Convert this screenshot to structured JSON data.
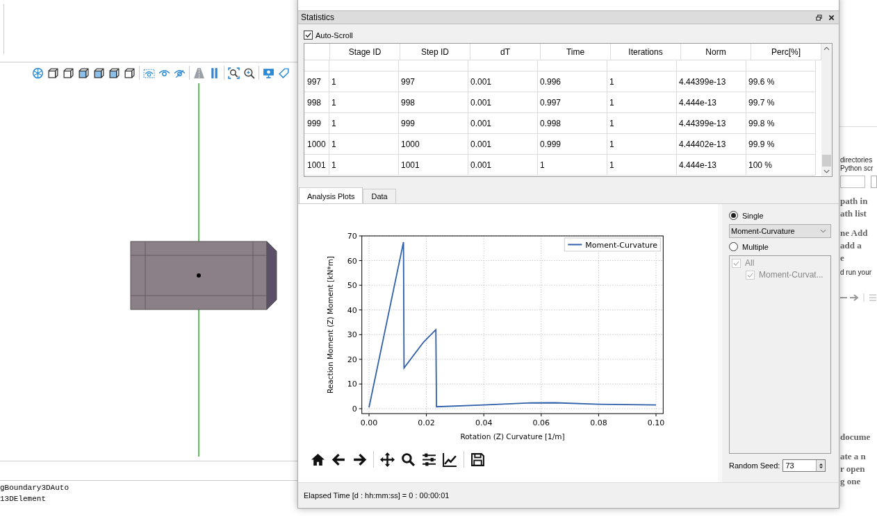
{
  "viewer": {
    "console_lines": [
      "gBoundary3DAuto",
      "13DElement"
    ]
  },
  "side_panel": {
    "lines": [
      {
        "text": "directories",
        "kind": "small"
      },
      {
        "text": "Python scr",
        "kind": "small"
      },
      {
        "text": "path in",
        "kind": "heading"
      },
      {
        "text": "ath list",
        "kind": "heading"
      },
      {
        "text": "ne Add",
        "kind": "heading"
      },
      {
        "text": "add a",
        "kind": "heading"
      },
      {
        "text": "e",
        "kind": "heading"
      },
      {
        "text": "d run your",
        "kind": "small"
      },
      {
        "text": "docume",
        "kind": "heading"
      },
      {
        "text": "ate a n",
        "kind": "heading"
      },
      {
        "text": "r open",
        "kind": "heading"
      },
      {
        "text": "g one",
        "kind": "heading"
      }
    ]
  },
  "monitor": {
    "panel_title": "Statistics",
    "auto_scroll": {
      "label": "Auto-Scroll",
      "checked": true
    },
    "table": {
      "columns": [
        "Stage ID",
        "Step ID",
        "dT",
        "Time",
        "Iterations",
        "Norm",
        "Perc[%]"
      ],
      "rows": [
        {
          "header": "997",
          "cells": [
            "1",
            "997",
            "0.001",
            "0.996",
            "1",
            "4.44399e-13",
            "99.6 %"
          ]
        },
        {
          "header": "998",
          "cells": [
            "1",
            "998",
            "0.001",
            "0.997",
            "1",
            "4.444e-13",
            "99.7 %"
          ]
        },
        {
          "header": "999",
          "cells": [
            "1",
            "999",
            "0.001",
            "0.998",
            "1",
            "4.44399e-13",
            "99.8 %"
          ]
        },
        {
          "header": "1000",
          "cells": [
            "1",
            "1000",
            "0.001",
            "0.999",
            "1",
            "4.44402e-13",
            "99.9 %"
          ]
        },
        {
          "header": "1001",
          "cells": [
            "1",
            "1001",
            "0.001",
            "1",
            "1",
            "4.444e-13",
            "100 %"
          ]
        }
      ]
    },
    "tabs": [
      {
        "label": "Analysis Plots",
        "selected": true
      },
      {
        "label": "Data",
        "selected": false
      }
    ],
    "chart_data": {
      "type": "line",
      "xlabel": "Rotation (Z) Curvature [1/m]",
      "ylabel": "Reaction Moment (Z) Moment [kN*m]",
      "x": [
        0,
        0.012,
        0.0122,
        0.019,
        0.0233,
        0.0235,
        0.04,
        0.055,
        0.065,
        0.08,
        0.1
      ],
      "series": [
        {
          "name": "Moment-Curvature",
          "color": "#2f5fa8",
          "values": [
            0.5,
            67.5,
            16.5,
            27,
            32,
            0.8,
            1.5,
            2.3,
            2.4,
            1.8,
            1.5
          ]
        }
      ],
      "xlim": [
        -0.0025,
        0.1025
      ],
      "ylim": [
        -2,
        70
      ],
      "xticks": [
        {
          "value": 0,
          "label": "0.00"
        },
        {
          "value": 0.02,
          "label": "0.02"
        },
        {
          "value": 0.04,
          "label": "0.04"
        },
        {
          "value": 0.06,
          "label": "0.06"
        },
        {
          "value": 0.08,
          "label": "0.08"
        },
        {
          "value": 0.1,
          "label": "0.10"
        }
      ],
      "yticks": [
        0,
        10,
        20,
        30,
        40,
        50,
        60,
        70
      ],
      "grid": true
    },
    "plot_mode": {
      "options": [
        {
          "label": "Single",
          "selected": true
        },
        {
          "label": "Multiple",
          "selected": false
        }
      ],
      "dropdown": "Moment-Curvature",
      "tree": {
        "label": "All",
        "checked": true,
        "disabled": true,
        "children": [
          {
            "label": "Moment-Curvat...",
            "checked": true,
            "disabled": true
          }
        ]
      },
      "random_seed": {
        "label": "Random Seed:",
        "value": "73"
      }
    },
    "status": "Elapsed Time [d : hh:mm:ss] = 0 : 00:00:01"
  }
}
